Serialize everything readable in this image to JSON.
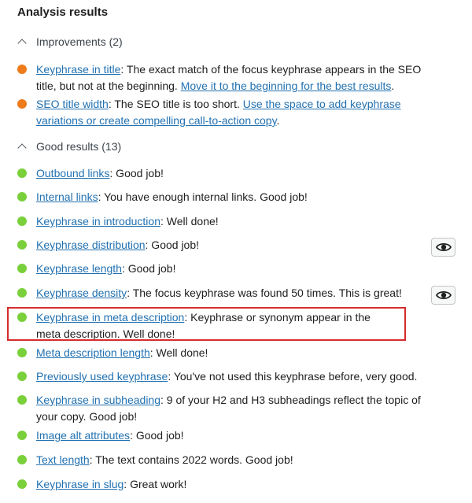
{
  "title": "Analysis results",
  "improvements": {
    "header": "Improvements (2)",
    "items": [
      {
        "link": "Keyphrase in title",
        "text": ": The exact match of the focus keyphrase appears in the SEO title, but not at the beginning. ",
        "link2": "Move it to the beginning for the best results",
        "tail": "."
      },
      {
        "link": "SEO title width",
        "text": ": The SEO title is too short. ",
        "link2": "Use the space to add keyphrase variations or create compelling call-to-action copy",
        "tail": "."
      }
    ]
  },
  "good": {
    "header": "Good results (13)",
    "items": [
      {
        "link": "Outbound links",
        "text": ": Good job!"
      },
      {
        "link": "Internal links",
        "text": ": You have enough internal links. Good job!"
      },
      {
        "link": "Keyphrase in introduction",
        "text": ": Well done!"
      },
      {
        "link": "Keyphrase distribution",
        "text": ": Good job!"
      },
      {
        "link": "Keyphrase length",
        "text": ": Good job!"
      },
      {
        "link": "Keyphrase density",
        "text": ": The focus keyphrase was found 50 times. This is great!"
      },
      {
        "link": "Keyphrase in meta description",
        "text": ": Keyphrase or synonym appear in the meta description. Well done!"
      },
      {
        "link": "Meta description length",
        "text": ": Well done!"
      },
      {
        "link": "Previously used keyphrase",
        "text": ": You've not used this keyphrase before, very good."
      },
      {
        "link": "Keyphrase in subheading",
        "text": ": 9 of your H2 and H3 subheadings reflect the topic of your copy. Good job!"
      },
      {
        "link": "Image alt attributes",
        "text": ": Good job!"
      },
      {
        "link": "Text length",
        "text": ": The text contains 2022 words. Good job!"
      },
      {
        "link": "Keyphrase in slug",
        "text": ": Great work!"
      }
    ]
  },
  "colors": {
    "improvement_dot": "#ee7c1b",
    "good_dot": "#7ad03a",
    "link": "#2271b1",
    "highlight_box": "#d62c2c"
  },
  "icons": {
    "eye": "eye-icon",
    "chevron": "chevron-up-icon"
  }
}
